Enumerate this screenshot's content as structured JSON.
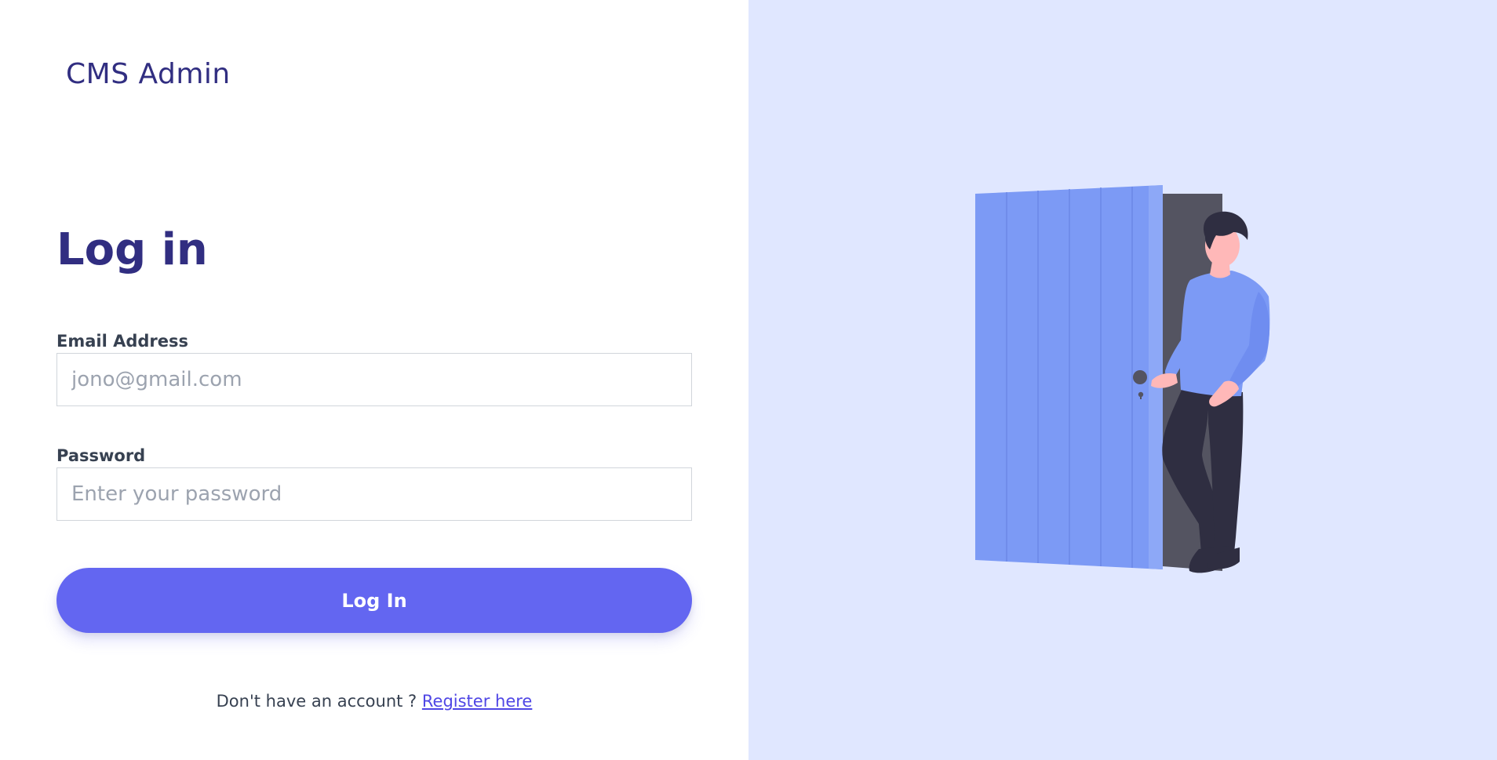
{
  "brand": {
    "title": "CMS Admin"
  },
  "login": {
    "heading": "Log in",
    "email": {
      "label": "Email Address",
      "placeholder": "jono@gmail.com",
      "value": ""
    },
    "password": {
      "label": "Password",
      "placeholder": "Enter your password",
      "value": ""
    },
    "submit_label": "Log In",
    "register_prompt": "Don't have an account ? ",
    "register_link": "Register here"
  },
  "illustration": {
    "icon": "person-opening-door-illustration"
  },
  "colors": {
    "brand": "#312e81",
    "accent": "#6366f1",
    "link": "#4f46e5",
    "panel_bg": "#e0e7ff",
    "door": "#7c9af5",
    "doorway": "#545461",
    "figure_dark": "#2f2e41",
    "skin": "#ffb8b8"
  }
}
